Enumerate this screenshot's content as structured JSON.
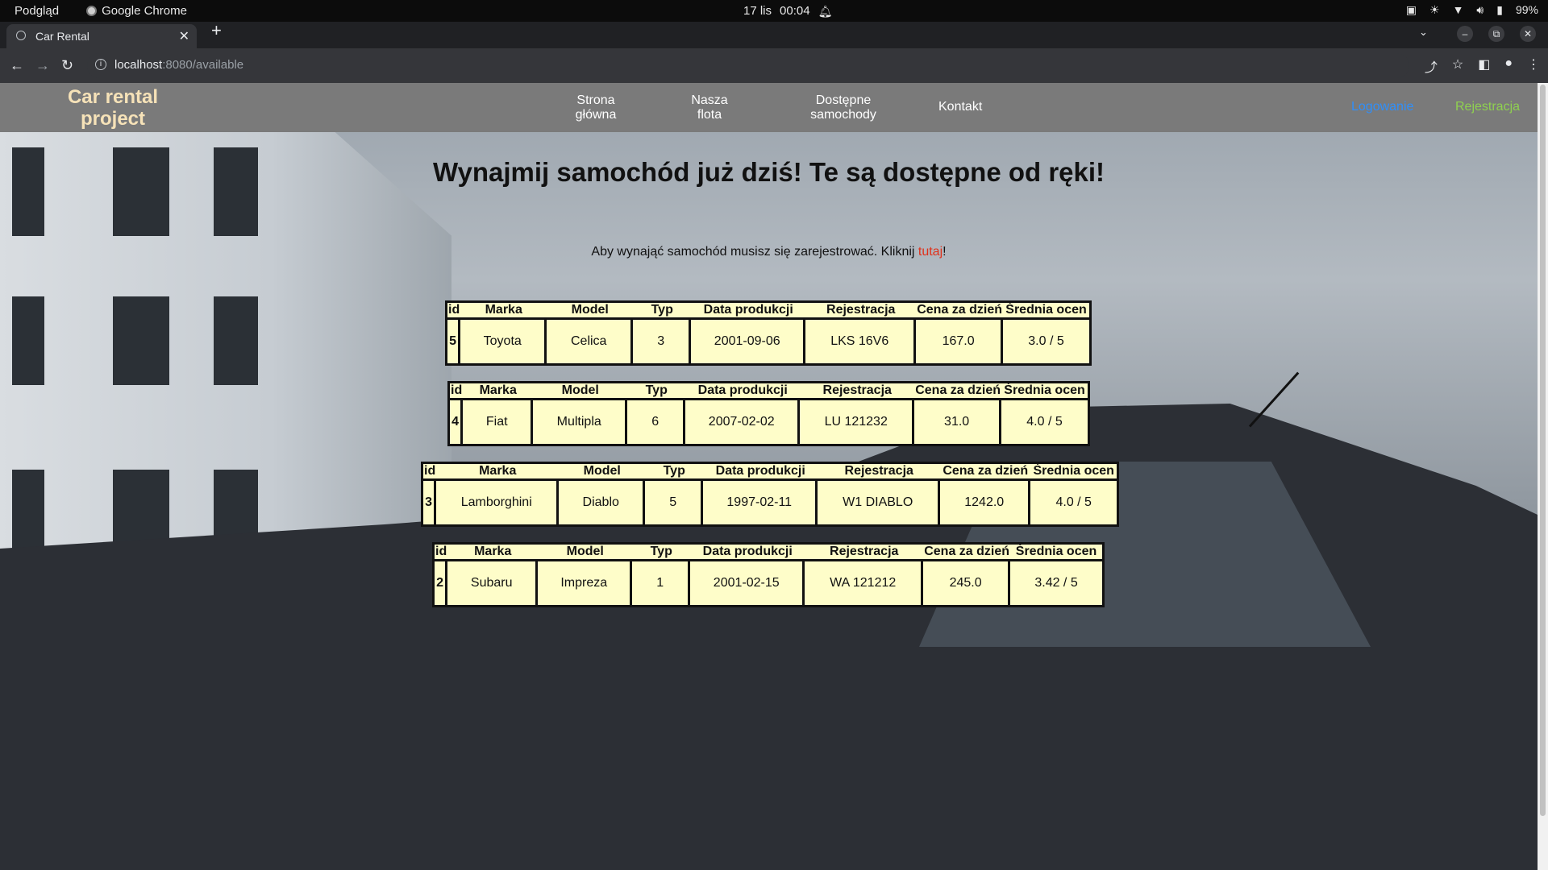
{
  "os": {
    "app_left": "Podgląd",
    "app_chrome": "Google Chrome",
    "date": "17 lis",
    "time": "00:04",
    "battery": "99%"
  },
  "browser": {
    "tab_title": "Car Rental",
    "url_host": "localhost",
    "url_path": ":8080/available"
  },
  "nav": {
    "brand": "Car rental project",
    "links": [
      "Strona główna",
      "Nasza flota",
      "Dostępne samochody",
      "Kontakt"
    ],
    "login": "Logowanie",
    "register": "Rejestracja"
  },
  "main": {
    "headline": "Wynajmij samochód już dziś! Te są dostępne od ręki!",
    "notice_before": "Aby wynająć samochód musisz się zarejestrować. Kliknij ",
    "notice_link": "tutaj",
    "notice_after": "!"
  },
  "table": {
    "headers": [
      "id",
      "Marka",
      "Model",
      "Typ",
      "Data produkcji",
      "Rejestracja",
      "Cena za dzień",
      "Średnia ocen"
    ],
    "cars": [
      [
        "5",
        "Toyota",
        "Celica",
        "3",
        "2001-09-06",
        "LKS 16V6",
        "167.0",
        "3.0 / 5"
      ],
      [
        "4",
        "Fiat",
        "Multipla",
        "6",
        "2007-02-02",
        "LU 121232",
        "31.0",
        "4.0 / 5"
      ],
      [
        "3",
        "Lamborghini",
        "Diablo",
        "5",
        "1997-02-11",
        "W1 DIABLO",
        "1242.0",
        "4.0 / 5"
      ],
      [
        "2",
        "Subaru",
        "Impreza",
        "1",
        "2001-02-15",
        "WA 121212",
        "245.0",
        "3.42 / 5"
      ]
    ]
  },
  "colors": {
    "table_bg": "#fefdc9",
    "brand": "#f6e2b8",
    "login": "#2f8ffb",
    "register": "#8fd14f",
    "link_red": "#e0311a",
    "navbar": "#7a7a7a"
  }
}
